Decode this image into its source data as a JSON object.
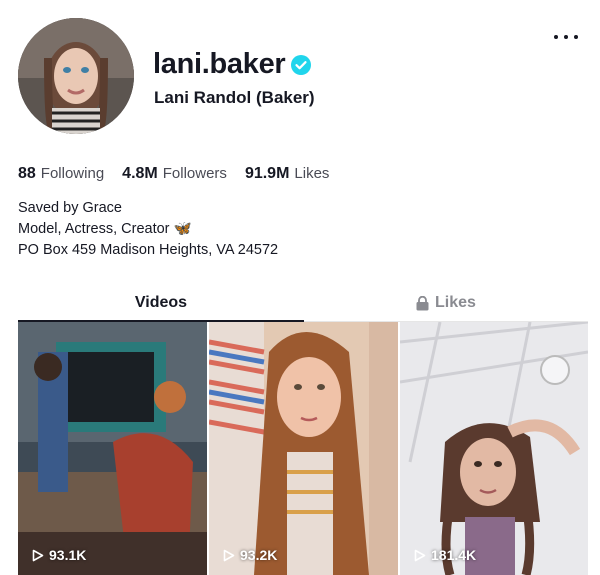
{
  "profile": {
    "username": "lani.baker",
    "display_name": "Lani Randol (Baker)",
    "verified": true,
    "verified_color": "#20D5EC"
  },
  "stats": {
    "following_count": "88",
    "following_label": "Following",
    "followers_count": "4.8M",
    "followers_label": "Followers",
    "likes_count": "91.9M",
    "likes_label": "Likes"
  },
  "bio": {
    "line1": "Saved by Grace",
    "line2": "Model, Actress, Creator 🦋",
    "line3": "PO Box 459 Madison Heights, VA 24572"
  },
  "tabs": {
    "videos_label": "Videos",
    "likes_label": "Likes",
    "active": "Videos"
  },
  "videos": [
    {
      "views": "93.1K"
    },
    {
      "views": "93.2K"
    },
    {
      "views": "181.4K"
    }
  ],
  "icons": {
    "more": "more-horizontal-icon",
    "verified": "verified-check-icon",
    "lock": "lock-icon",
    "play": "play-icon"
  }
}
